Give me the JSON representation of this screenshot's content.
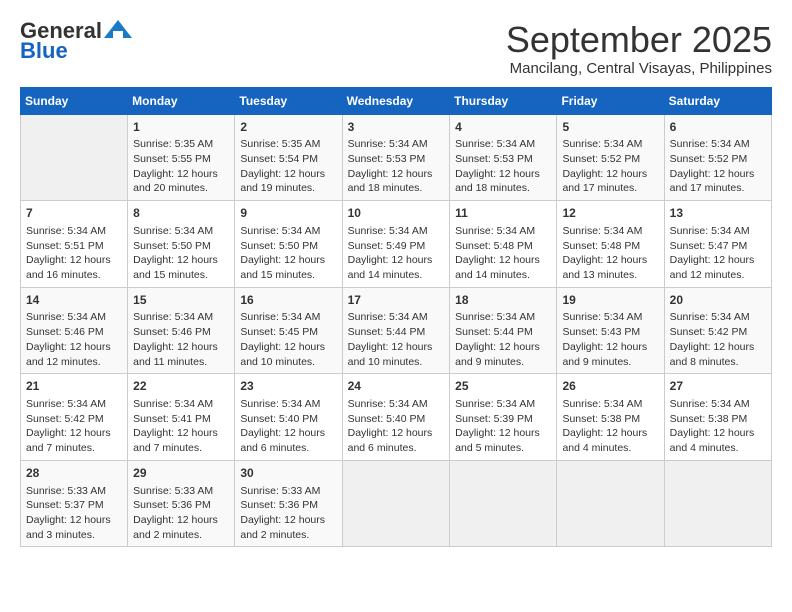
{
  "header": {
    "logo_general": "General",
    "logo_blue": "Blue",
    "month": "September 2025",
    "location": "Mancilang, Central Visayas, Philippines"
  },
  "days_of_week": [
    "Sunday",
    "Monday",
    "Tuesday",
    "Wednesday",
    "Thursday",
    "Friday",
    "Saturday"
  ],
  "weeks": [
    [
      {
        "day": "",
        "info": ""
      },
      {
        "day": "1",
        "info": "Sunrise: 5:35 AM\nSunset: 5:55 PM\nDaylight: 12 hours\nand 20 minutes."
      },
      {
        "day": "2",
        "info": "Sunrise: 5:35 AM\nSunset: 5:54 PM\nDaylight: 12 hours\nand 19 minutes."
      },
      {
        "day": "3",
        "info": "Sunrise: 5:34 AM\nSunset: 5:53 PM\nDaylight: 12 hours\nand 18 minutes."
      },
      {
        "day": "4",
        "info": "Sunrise: 5:34 AM\nSunset: 5:53 PM\nDaylight: 12 hours\nand 18 minutes."
      },
      {
        "day": "5",
        "info": "Sunrise: 5:34 AM\nSunset: 5:52 PM\nDaylight: 12 hours\nand 17 minutes."
      },
      {
        "day": "6",
        "info": "Sunrise: 5:34 AM\nSunset: 5:52 PM\nDaylight: 12 hours\nand 17 minutes."
      }
    ],
    [
      {
        "day": "7",
        "info": "Sunrise: 5:34 AM\nSunset: 5:51 PM\nDaylight: 12 hours\nand 16 minutes."
      },
      {
        "day": "8",
        "info": "Sunrise: 5:34 AM\nSunset: 5:50 PM\nDaylight: 12 hours\nand 15 minutes."
      },
      {
        "day": "9",
        "info": "Sunrise: 5:34 AM\nSunset: 5:50 PM\nDaylight: 12 hours\nand 15 minutes."
      },
      {
        "day": "10",
        "info": "Sunrise: 5:34 AM\nSunset: 5:49 PM\nDaylight: 12 hours\nand 14 minutes."
      },
      {
        "day": "11",
        "info": "Sunrise: 5:34 AM\nSunset: 5:48 PM\nDaylight: 12 hours\nand 14 minutes."
      },
      {
        "day": "12",
        "info": "Sunrise: 5:34 AM\nSunset: 5:48 PM\nDaylight: 12 hours\nand 13 minutes."
      },
      {
        "day": "13",
        "info": "Sunrise: 5:34 AM\nSunset: 5:47 PM\nDaylight: 12 hours\nand 12 minutes."
      }
    ],
    [
      {
        "day": "14",
        "info": "Sunrise: 5:34 AM\nSunset: 5:46 PM\nDaylight: 12 hours\nand 12 minutes."
      },
      {
        "day": "15",
        "info": "Sunrise: 5:34 AM\nSunset: 5:46 PM\nDaylight: 12 hours\nand 11 minutes."
      },
      {
        "day": "16",
        "info": "Sunrise: 5:34 AM\nSunset: 5:45 PM\nDaylight: 12 hours\nand 10 minutes."
      },
      {
        "day": "17",
        "info": "Sunrise: 5:34 AM\nSunset: 5:44 PM\nDaylight: 12 hours\nand 10 minutes."
      },
      {
        "day": "18",
        "info": "Sunrise: 5:34 AM\nSunset: 5:44 PM\nDaylight: 12 hours\nand 9 minutes."
      },
      {
        "day": "19",
        "info": "Sunrise: 5:34 AM\nSunset: 5:43 PM\nDaylight: 12 hours\nand 9 minutes."
      },
      {
        "day": "20",
        "info": "Sunrise: 5:34 AM\nSunset: 5:42 PM\nDaylight: 12 hours\nand 8 minutes."
      }
    ],
    [
      {
        "day": "21",
        "info": "Sunrise: 5:34 AM\nSunset: 5:42 PM\nDaylight: 12 hours\nand 7 minutes."
      },
      {
        "day": "22",
        "info": "Sunrise: 5:34 AM\nSunset: 5:41 PM\nDaylight: 12 hours\nand 7 minutes."
      },
      {
        "day": "23",
        "info": "Sunrise: 5:34 AM\nSunset: 5:40 PM\nDaylight: 12 hours\nand 6 minutes."
      },
      {
        "day": "24",
        "info": "Sunrise: 5:34 AM\nSunset: 5:40 PM\nDaylight: 12 hours\nand 6 minutes."
      },
      {
        "day": "25",
        "info": "Sunrise: 5:34 AM\nSunset: 5:39 PM\nDaylight: 12 hours\nand 5 minutes."
      },
      {
        "day": "26",
        "info": "Sunrise: 5:34 AM\nSunset: 5:38 PM\nDaylight: 12 hours\nand 4 minutes."
      },
      {
        "day": "27",
        "info": "Sunrise: 5:34 AM\nSunset: 5:38 PM\nDaylight: 12 hours\nand 4 minutes."
      }
    ],
    [
      {
        "day": "28",
        "info": "Sunrise: 5:33 AM\nSunset: 5:37 PM\nDaylight: 12 hours\nand 3 minutes."
      },
      {
        "day": "29",
        "info": "Sunrise: 5:33 AM\nSunset: 5:36 PM\nDaylight: 12 hours\nand 2 minutes."
      },
      {
        "day": "30",
        "info": "Sunrise: 5:33 AM\nSunset: 5:36 PM\nDaylight: 12 hours\nand 2 minutes."
      },
      {
        "day": "",
        "info": ""
      },
      {
        "day": "",
        "info": ""
      },
      {
        "day": "",
        "info": ""
      },
      {
        "day": "",
        "info": ""
      }
    ]
  ]
}
